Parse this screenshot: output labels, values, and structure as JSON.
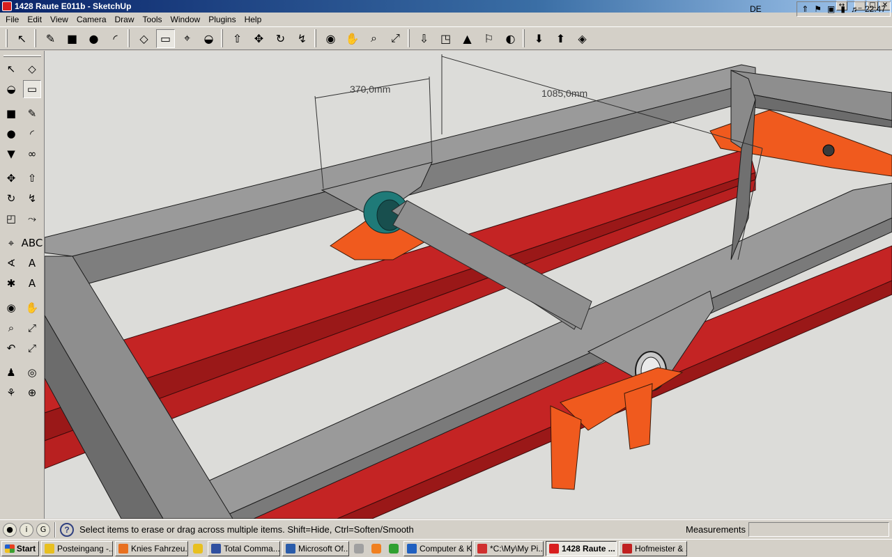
{
  "window": {
    "title": "1428 Raute E011b - SketchUp"
  },
  "window_buttons": [
    "↔",
    "_",
    "□",
    "✕"
  ],
  "menu": [
    "File",
    "Edit",
    "View",
    "Camera",
    "Draw",
    "Tools",
    "Window",
    "Plugins",
    "Help"
  ],
  "toolbar_top": [
    {
      "name": "select-tool",
      "glyph": "↖"
    },
    {
      "name": "pencil-tool",
      "glyph": "✎"
    },
    {
      "name": "rectangle-tool",
      "glyph": "■"
    },
    {
      "name": "circle-tool",
      "glyph": "●"
    },
    {
      "name": "arc-tool",
      "glyph": "◜"
    },
    {
      "name": "make-component-tool",
      "glyph": "◇"
    },
    {
      "name": "eraser-tool",
      "glyph": "▭"
    },
    {
      "name": "tape-measure-tool",
      "glyph": "⌖"
    },
    {
      "name": "paint-bucket-tool",
      "glyph": "◒"
    },
    {
      "name": "push-pull-tool",
      "glyph": "⇧"
    },
    {
      "name": "move-tool",
      "glyph": "✥"
    },
    {
      "name": "rotate-tool",
      "glyph": "↻"
    },
    {
      "name": "follow-me-tool",
      "glyph": "↯"
    },
    {
      "name": "orbit-tool",
      "glyph": "◉"
    },
    {
      "name": "pan-tool",
      "glyph": "✋"
    },
    {
      "name": "zoom-tool",
      "glyph": "⌕"
    },
    {
      "name": "zoom-extents-tool",
      "glyph": "⤢"
    },
    {
      "name": "get-models-tool",
      "glyph": "⇩"
    },
    {
      "name": "share-model-tool",
      "glyph": "◳"
    },
    {
      "name": "google-earth-tool",
      "glyph": "▲"
    },
    {
      "name": "add-location-tool",
      "glyph": "⚐"
    },
    {
      "name": "toggle-terrain-tool",
      "glyph": "◐"
    },
    {
      "name": "get-components-tool",
      "glyph": "⬇"
    },
    {
      "name": "share-component-tool",
      "glyph": "⬆"
    },
    {
      "name": "extension-tool",
      "glyph": "◈"
    }
  ],
  "toolbar_left": [
    [
      "select-tool",
      "make-component-tool"
    ],
    [
      "paint-bucket-tool",
      "eraser-tool"
    ],
    [
      "rectangle-tool",
      "line-tool"
    ],
    [
      "circle-tool",
      "arc-tool"
    ],
    [
      "polygon-tool",
      "freehand-tool"
    ],
    [
      "move-tool",
      "push-pull-tool"
    ],
    [
      "rotate-tool",
      "follow-me-tool"
    ],
    [
      "scale-tool",
      "offset-tool"
    ],
    [
      "tape-measure-tool",
      "dimension-tool"
    ],
    [
      "protractor-tool",
      "text-tool"
    ],
    [
      "axes-tool",
      "3d-text-tool"
    ],
    [
      "orbit-tool",
      "pan-tool"
    ],
    [
      "zoom-tool",
      "zoom-window-tool"
    ],
    [
      "previous-view-tool",
      "zoom-extents-tool"
    ],
    [
      "position-camera-tool",
      "look-around-tool"
    ],
    [
      "walk-tool",
      "section-plane-tool"
    ]
  ],
  "toolbar_left_glyphs": [
    [
      "↖",
      "◇"
    ],
    [
      "◒",
      "▭"
    ],
    [
      "■",
      "✎"
    ],
    [
      "●",
      "◜"
    ],
    [
      "▼",
      "∞"
    ],
    [
      "✥",
      "⇧"
    ],
    [
      "↻",
      "↯"
    ],
    [
      "◰",
      "⤳"
    ],
    [
      "⌖",
      "ABC"
    ],
    [
      "∢",
      "A"
    ],
    [
      "✱",
      "A"
    ],
    [
      "◉",
      "✋"
    ],
    [
      "⌕",
      "⤢"
    ],
    [
      "↶",
      "⤢"
    ],
    [
      "♟",
      "◎"
    ],
    [
      "⚘",
      "⊕"
    ]
  ],
  "viewport": {
    "dimensions": [
      {
        "label": "370,0mm"
      },
      {
        "label": "1085,0mm"
      }
    ],
    "colors": {
      "background": "#dcdcd9",
      "steel_gray": "#8a8a8a",
      "steel_gray_dark": "#6c6c6c",
      "beam_red": "#c42424",
      "beam_red_dark": "#9a1818",
      "bracket_orange": "#f05a1e",
      "bearing_teal": "#1f7a78",
      "shaft_gray": "#8c8c8c"
    }
  },
  "status": {
    "message": "Select items to erase or drag across multiple items. Shift=Hide, Ctrl=Soften/Smooth",
    "measurements_label": "Measurements",
    "measurements_value": ""
  },
  "taskbar": {
    "start": "Start",
    "tasks": [
      {
        "label": "Posteingang -...",
        "color": "#e8c020",
        "active": false
      },
      {
        "label": "Knies Fahrzeu...",
        "color": "#e87020",
        "active": false
      },
      {
        "label": "",
        "color": "#e8c020",
        "active": false,
        "quick": true
      },
      {
        "label": "Total Comma...",
        "color": "#3050a0",
        "active": false
      },
      {
        "label": "Microsoft Of...",
        "color": "#2a5caa",
        "active": false
      },
      {
        "label": "",
        "color": "#a0a0a0",
        "active": false,
        "quick": true
      },
      {
        "label": "",
        "color": "#f08020",
        "active": false,
        "quick": true
      },
      {
        "label": "",
        "color": "#30a030",
        "active": false,
        "quick": true
      },
      {
        "label": "Computer & K...",
        "color": "#2060c0",
        "active": false
      },
      {
        "label": "*C:\\My\\My Pi...",
        "color": "#d03030",
        "active": false
      },
      {
        "label": "1428 Raute ...",
        "color": "#d81e1e",
        "active": true
      },
      {
        "label": "Hofmeister & ...",
        "color": "#c02020",
        "active": false
      }
    ],
    "language": "DE",
    "clock": "22:47"
  }
}
